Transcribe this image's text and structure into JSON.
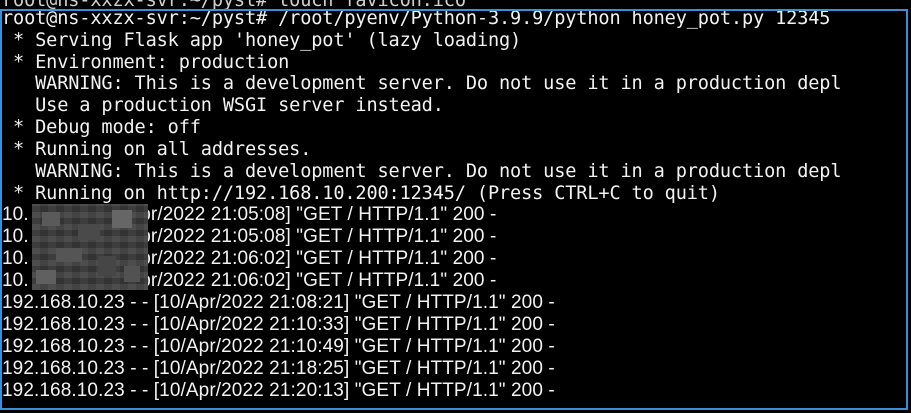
{
  "terminal": {
    "lines": {
      "l0": "root@ns-xxzx-svr:~/pyst# touch favicon.ico",
      "l1": "root@ns-xxzx-svr:~/pyst# /root/pyenv/Python-3.9.9/python honey_pot.py 12345",
      "l2": " * Serving Flask app 'honey_pot' (lazy loading)",
      "l3": " * Environment: production",
      "l4": "   WARNING: This is a development server. Do not use it in a production depl",
      "l5": "   Use a production WSGI server instead.",
      "l6": " * Debug mode: off",
      "l7": " * Running on all addresses.",
      "l8": "   WARNING: This is a development server. Do not use it in a production depl",
      "l9": " * Running on http://192.168.10.200:12345/ (Press CTRL+C to quit)"
    },
    "log_rows": [
      {
        "ip": "10.",
        "rest": "        - - [10/Apr/2022 21:05:08] \"GET / HTTP/1.1\" 200 -"
      },
      {
        "ip": "10.",
        "rest": "        - - [10/Apr/2022 21:05:08] \"GET / HTTP/1.1\" 200 -"
      },
      {
        "ip": "10.",
        "rest": "        - - [10/Apr/2022 21:06:02] \"GET / HTTP/1.1\" 200 -"
      },
      {
        "ip": "10.",
        "rest": "        - - [10/Apr/2022 21:06:02] \"GET / HTTP/1.1\" 200 -"
      },
      {
        "ip": "192.168.10.23",
        "rest": " - - [10/Apr/2022 21:08:21] \"GET / HTTP/1.1\" 200 -"
      },
      {
        "ip": "192.168.10.23",
        "rest": " - - [10/Apr/2022 21:10:33] \"GET / HTTP/1.1\" 200 -"
      },
      {
        "ip": "192.168.10.23",
        "rest": " - - [10/Apr/2022 21:10:49] \"GET / HTTP/1.1\" 200 -"
      },
      {
        "ip": "192.168.10.23",
        "rest": " - - [10/Apr/2022 21:18:25] \"GET / HTTP/1.1\" 200 -"
      },
      {
        "ip": "192.168.10.23",
        "rest": " - - [10/Apr/2022 21:20:13] \"GET / HTTP/1.1\" 200 -"
      }
    ]
  },
  "colors": {
    "background": "#000000",
    "text": "#f2f2f2",
    "selection_border": "#3b8fd6"
  }
}
